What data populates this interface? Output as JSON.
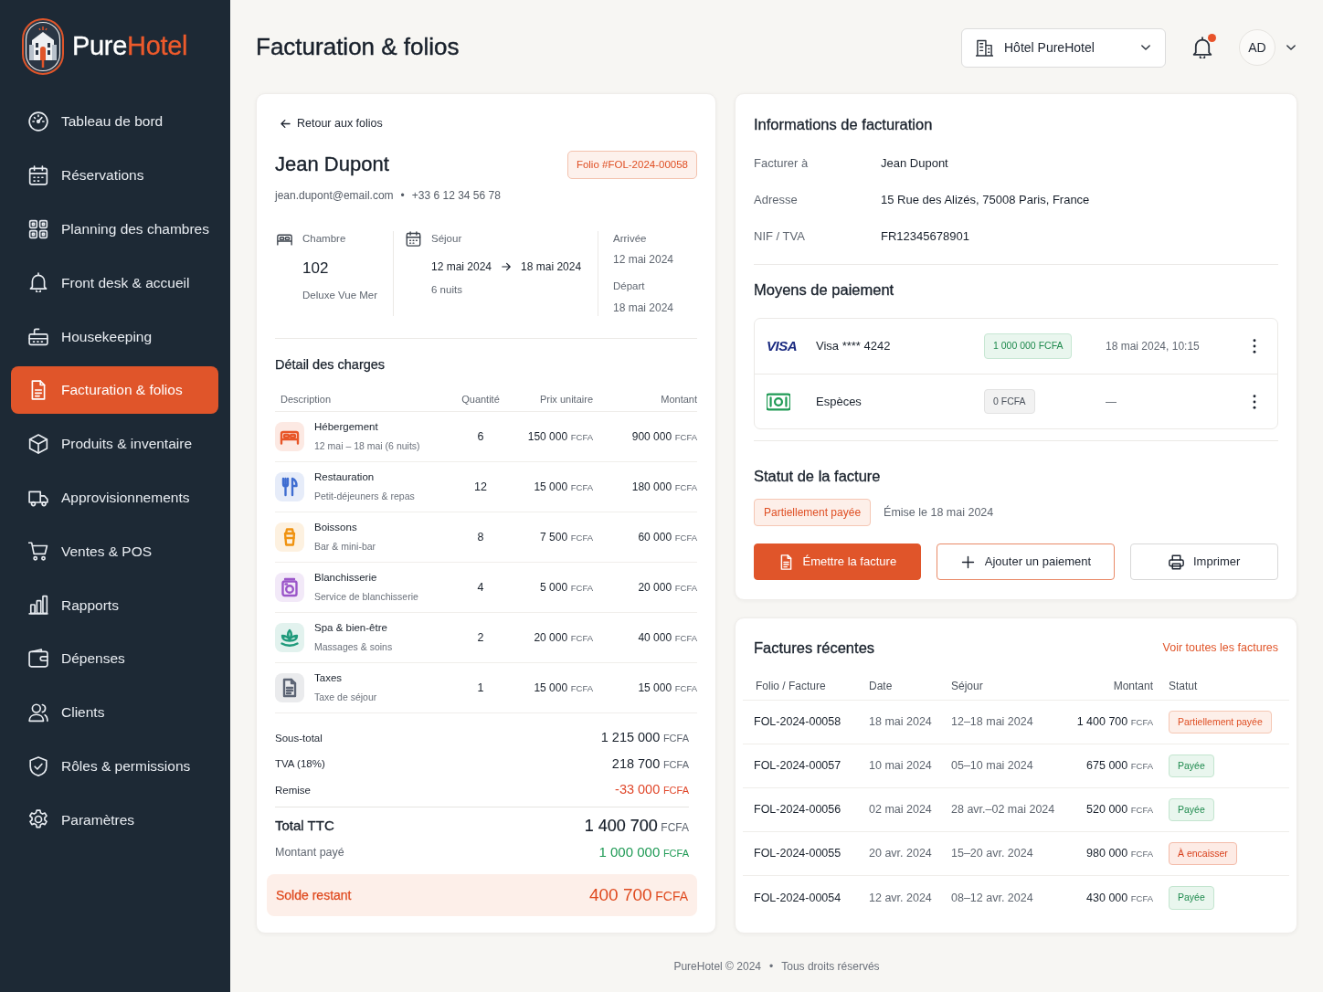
{
  "sidebar": {
    "logo": {
      "name_start": "Pure",
      "name_end": "Hotel"
    },
    "items": [
      {
        "label": "Tableau de bord",
        "kind": "dashboard",
        "selected": false
      },
      {
        "label": "Réservations",
        "kind": "reservations",
        "selected": false
      },
      {
        "label": "Planning des chambres",
        "kind": "planning",
        "selected": false
      },
      {
        "label": "Front desk & accueil",
        "kind": "front_desk",
        "selected": false
      },
      {
        "label": "Housekeeping",
        "kind": "housekeeping",
        "selected": false
      },
      {
        "label": "Facturation & folios",
        "kind": "billing",
        "selected": true
      },
      {
        "label": "Produits & inventaire",
        "kind": "inventory",
        "selected": false
      },
      {
        "label": "Approvisionnements",
        "kind": "procurement",
        "selected": false
      },
      {
        "label": "Ventes & POS",
        "kind": "sales",
        "selected": false
      },
      {
        "label": "Rapports",
        "kind": "reports",
        "selected": false
      },
      {
        "label": "Dépenses",
        "kind": "expenses",
        "selected": false
      },
      {
        "label": "Clients",
        "kind": "clients",
        "selected": false
      },
      {
        "label": "Rôles & permissions",
        "kind": "roles",
        "selected": false
      },
      {
        "label": "Paramètres",
        "kind": "settings",
        "selected": false
      }
    ]
  },
  "header": {
    "title": "Facturation & folios",
    "hotel_select": {
      "value": "Hôtel PureHotel"
    },
    "notifications": {
      "unread": true
    },
    "user": {
      "initials": "AD"
    }
  },
  "folio": {
    "back_link": "Retour aux folios",
    "guest": {
      "name": "Jean Dupont",
      "email": "jean.dupont@email.com",
      "separator": "•",
      "phone": "+33 6 12 34 56 78"
    },
    "folio_badge": "Folio #FOL-2024-00058",
    "room": {
      "label": "Chambre",
      "number": "102",
      "type": "Deluxe Vue Mer"
    },
    "stay": {
      "label": "Séjour",
      "from": "12 mai 2024",
      "to": "18 mai 2024",
      "nights": "6 nuits"
    },
    "dates": [
      {
        "label": "Arrivée",
        "value": "12 mai 2024"
      },
      {
        "label": "Départ",
        "value": "18 mai 2024"
      }
    ],
    "charges": {
      "title": "Détail des charges",
      "columns": [
        "Description",
        "Quantité",
        "Prix unitaire",
        "Montant"
      ],
      "rows": [
        {
          "kind": "lodging",
          "color": "#fce9e3",
          "name": "Hébergement",
          "detail": "12 mai – 18 mai (6 nuits)",
          "quantity": "6",
          "unit_price": {
            "value": "150 000",
            "currency": "FCFA"
          },
          "amount": {
            "value": "900 000",
            "currency": "FCFA"
          }
        },
        {
          "kind": "food",
          "color": "#e6ecf9",
          "name": "Restauration",
          "detail": "Petit-déjeuners & repas",
          "quantity": "12",
          "unit_price": {
            "value": "15 000",
            "currency": "FCFA"
          },
          "amount": {
            "value": "180 000",
            "currency": "FCFA"
          }
        },
        {
          "kind": "drinks",
          "color": "#fdf1e0",
          "name": "Boissons",
          "detail": "Bar & mini-bar",
          "quantity": "8",
          "unit_price": {
            "value": "7 500",
            "currency": "FCFA"
          },
          "amount": {
            "value": "60 000",
            "currency": "FCFA"
          }
        },
        {
          "kind": "laundry",
          "color": "#f2e9f8",
          "name": "Blanchisserie",
          "detail": "Service de blanchisserie",
          "quantity": "4",
          "unit_price": {
            "value": "5 000",
            "currency": "FCFA"
          },
          "amount": {
            "value": "20 000",
            "currency": "FCFA"
          }
        },
        {
          "kind": "spa",
          "color": "#e2f2ee",
          "name": "Spa & bien-être",
          "detail": "Massages & soins",
          "quantity": "2",
          "unit_price": {
            "value": "20 000",
            "currency": "FCFA"
          },
          "amount": {
            "value": "40 000",
            "currency": "FCFA"
          }
        },
        {
          "kind": "tax",
          "color": "#eaebed",
          "name": "Taxes",
          "detail": "Taxe de séjour",
          "quantity": "1",
          "unit_price": {
            "value": "15 000",
            "currency": "FCFA"
          },
          "amount": {
            "value": "15 000",
            "currency": "FCFA"
          }
        }
      ]
    },
    "totals": [
      {
        "kind": "line",
        "label": "Sous-total",
        "value": "1 215 000",
        "currency": "FCFA"
      },
      {
        "kind": "line",
        "label": "TVA (18%)",
        "value": "218 700",
        "currency": "FCFA"
      },
      {
        "kind": "discount",
        "label": "Remise",
        "value": "-33 000",
        "currency": "FCFA"
      },
      {
        "kind": "total",
        "label": "Total TTC",
        "value": "1 400 700",
        "currency": "FCFA"
      },
      {
        "kind": "paid",
        "label": "Montant payé",
        "value": "1 000 000",
        "currency": "FCFA"
      },
      {
        "kind": "balance",
        "label": "Solde restant",
        "value": "400 700",
        "currency": "FCFA"
      }
    ]
  },
  "billing": {
    "title": "Informations de facturation",
    "fields": [
      {
        "label": "Facturer à",
        "value": "Jean Dupont"
      },
      {
        "label": "Adresse",
        "value": "15 Rue des Alizés, 75008 Paris, France"
      },
      {
        "label": "NIF / TVA",
        "value": "FR12345678901"
      }
    ]
  },
  "payments": {
    "title": "Moyens de paiement",
    "items": [
      {
        "kind": "card",
        "brand": "VISA",
        "label": "Visa **** 4242",
        "amount": "1 000 000 FCFA",
        "settled": true,
        "date": "18 mai 2024, 10:15"
      },
      {
        "kind": "cash",
        "label": "Espèces",
        "amount": "0 FCFA",
        "settled": false,
        "date": "—"
      }
    ]
  },
  "invoice_status": {
    "title": "Statut de la facture",
    "status": {
      "label": "Partiellement payée",
      "kind": "partial"
    },
    "issued": "Émise le 18 mai 2024",
    "actions": [
      {
        "label": "Émettre la facture",
        "kind": "issue"
      },
      {
        "label": "Ajouter un paiement",
        "kind": "add"
      },
      {
        "label": "Imprimer",
        "kind": "print"
      }
    ]
  },
  "recent_invoices": {
    "title": "Factures récentes",
    "link": "Voir toutes les factures",
    "columns": [
      "Folio / Facture",
      "Date",
      "Séjour",
      "Montant",
      "Statut"
    ],
    "rows": [
      {
        "folio": "FOL-2024-00058",
        "date": "18 mai 2024",
        "stay": "12–18 mai 2024",
        "amount": "1 400 700",
        "currency": "FCFA",
        "status": {
          "label": "Partiellement payée",
          "kind": "partial"
        }
      },
      {
        "folio": "FOL-2024-00057",
        "date": "10 mai 2024",
        "stay": "05–10 mai 2024",
        "amount": "675 000",
        "currency": "FCFA",
        "status": {
          "label": "Payée",
          "kind": "paid"
        }
      },
      {
        "folio": "FOL-2024-00056",
        "date": "02 mai 2024",
        "stay": "28 avr.–02 mai 2024",
        "amount": "520 000",
        "currency": "FCFA",
        "status": {
          "label": "Payée",
          "kind": "paid"
        }
      },
      {
        "folio": "FOL-2024-00055",
        "date": "20 avr. 2024",
        "stay": "15–20 avr. 2024",
        "amount": "980 000",
        "currency": "FCFA",
        "status": {
          "label": "À encaisser",
          "kind": "due"
        }
      },
      {
        "folio": "FOL-2024-00054",
        "date": "12 avr. 2024",
        "stay": "08–12 avr. 2024",
        "amount": "430 000",
        "currency": "FCFA",
        "status": {
          "label": "Payée",
          "kind": "paid"
        }
      }
    ]
  },
  "footer": {
    "copyright": "PureHotel © 2024",
    "separator": "•",
    "rights": "Tous droits réservés"
  }
}
